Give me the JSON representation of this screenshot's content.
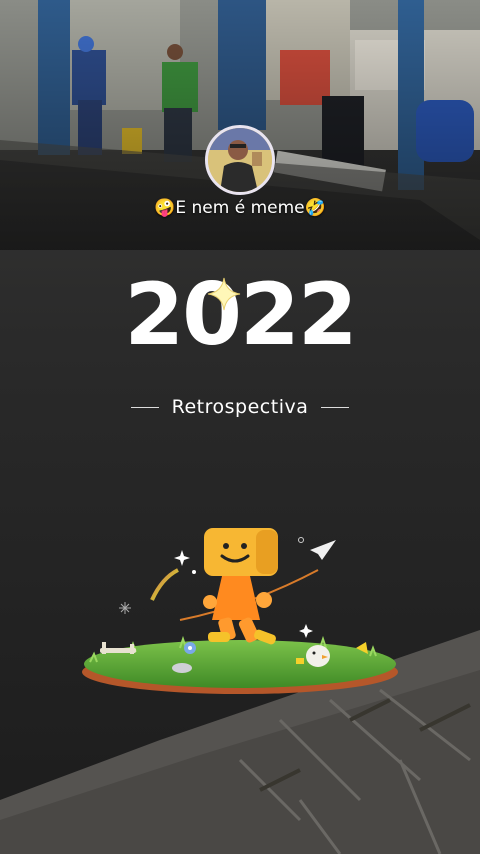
{
  "profile": {
    "username": "🤪E nem é meme🤣"
  },
  "recap": {
    "year": "2022",
    "subtitle": "Retrospectiva"
  },
  "colors": {
    "background": "#1e1e1e",
    "text": "#ffffff",
    "mascot_head": "#f7b733",
    "mascot_body": "#ff8a1f",
    "grass": "#4f9a2e"
  }
}
